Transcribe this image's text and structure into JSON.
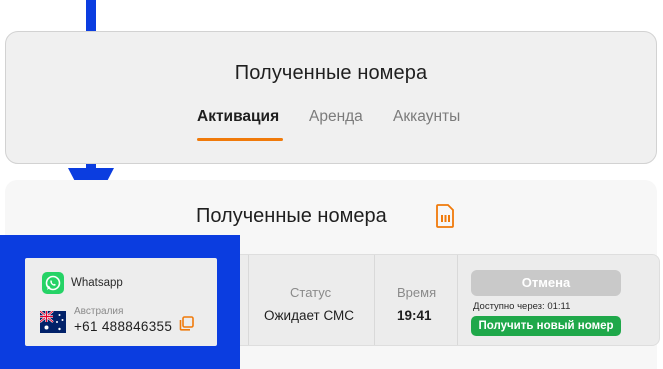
{
  "top_panel": {
    "title": "Полученные номера",
    "tabs": [
      {
        "label": "Активация",
        "active": true
      },
      {
        "label": "Аренда",
        "active": false
      },
      {
        "label": "Аккаунты",
        "active": false
      }
    ]
  },
  "card": {
    "title": "Полученные номера",
    "service": {
      "name": "Whatsapp",
      "icon": "whatsapp-icon"
    },
    "country": "Австралия",
    "phone": "+61 488846355",
    "status_header": "Статус",
    "status_value": "Ожидает СМС",
    "time_header": "Время",
    "time_value": "19:41",
    "cancel_label": "Отмена",
    "available_text": "Доступно через:  01:11",
    "new_number_label": "Получить новый номер"
  },
  "colors": {
    "accent": "#f07a0a",
    "highlight": "#0b3de0",
    "success": "#1fa84a",
    "disabled": "#c9c9c9"
  }
}
